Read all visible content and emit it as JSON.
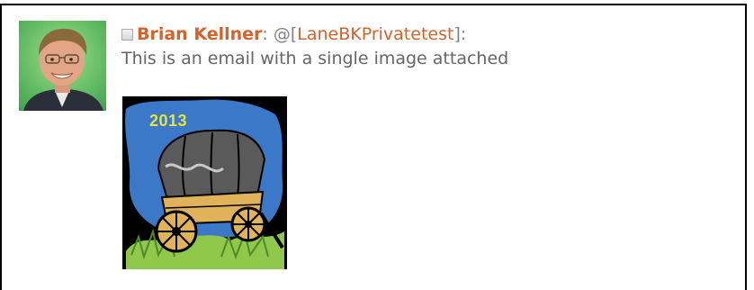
{
  "post": {
    "author": "Brian Kellner",
    "author_colon": ":",
    "mention_at": "@",
    "mention_open": "[",
    "mention_name": "LaneBKPrivatetest",
    "mention_close": "]",
    "mention_colon": ":",
    "message": "This is an email with a single image attached"
  },
  "attachment": {
    "year_text": "2013",
    "icon": "covered-wagon-clipart"
  },
  "avatar": {
    "icon": "user-avatar-photo"
  },
  "colors": {
    "author": "#d4622b",
    "mention": "#d4622b",
    "message": "#666666",
    "punctuation": "#808080",
    "frame_border": "#000000"
  }
}
